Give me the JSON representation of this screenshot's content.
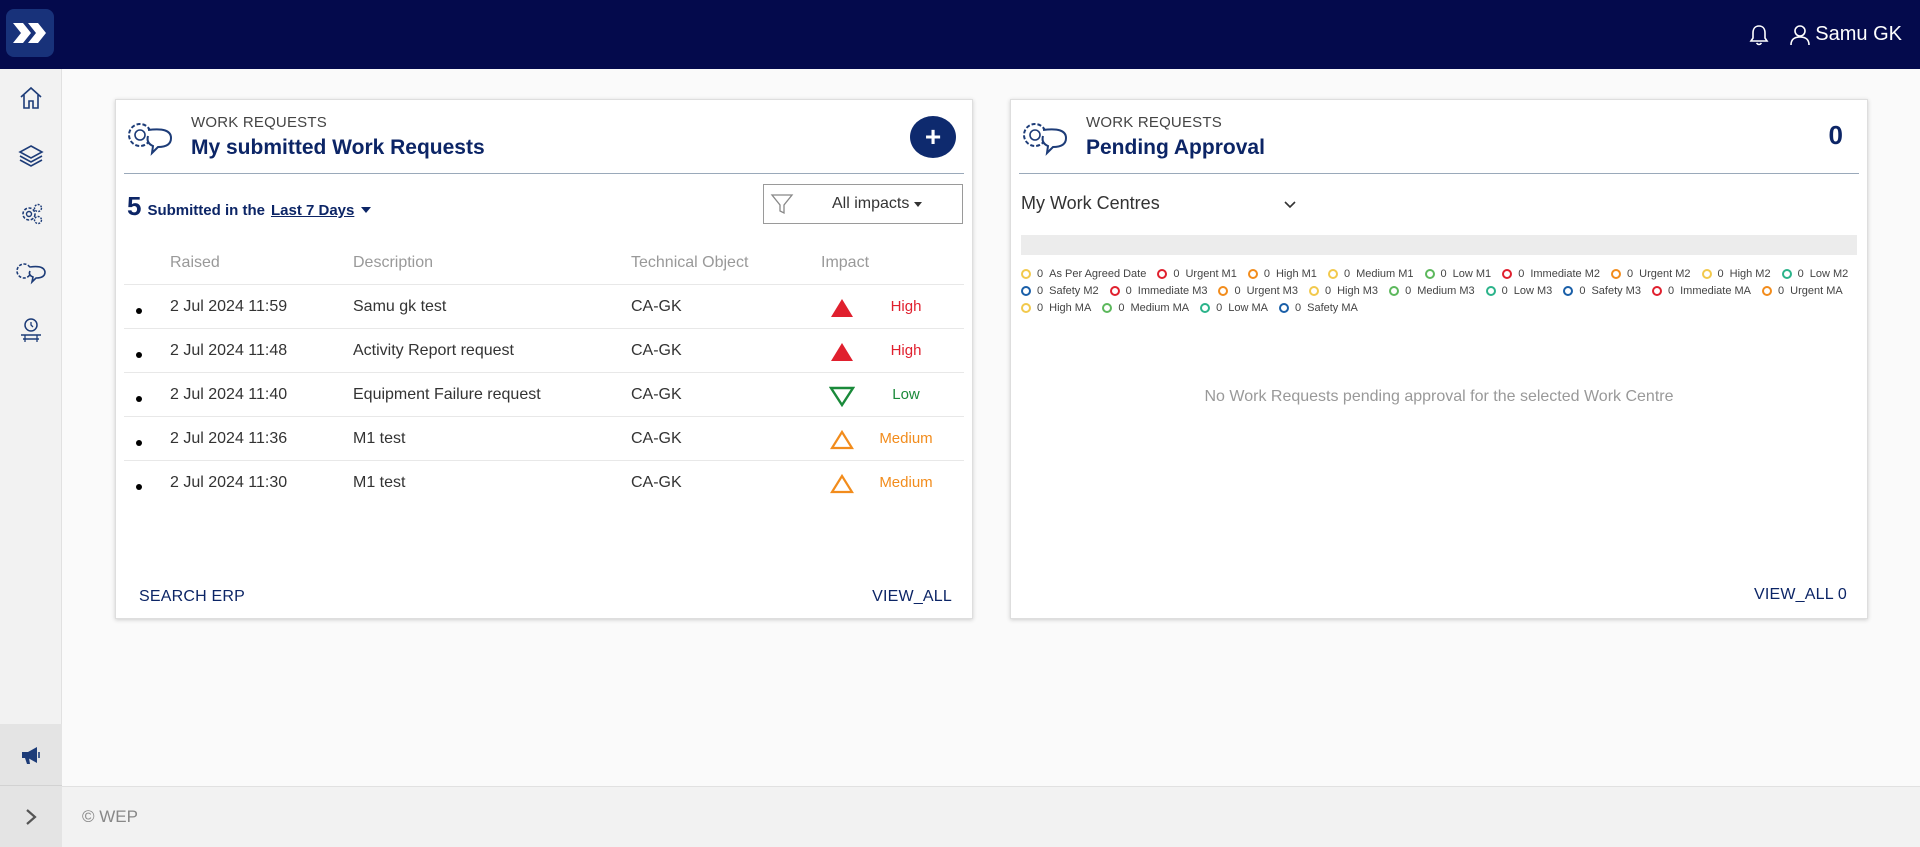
{
  "header": {
    "user_name": "Samu GK"
  },
  "footer": {
    "copyright": "© WEP"
  },
  "card_submitted": {
    "kicker": "WORK REQUESTS",
    "title": "My submitted Work Requests",
    "add_label": "+",
    "count": "5",
    "submitted_label": "Submitted in the",
    "period": "Last 7 Days",
    "filter": "All impacts",
    "columns": [
      "Raised",
      "Description",
      "Technical Object",
      "Impact"
    ],
    "rows": [
      {
        "raised": "2 Jul 2024 11:59",
        "description": "Samu gk test",
        "object": "CA-GK",
        "impact": "High",
        "impact_color": "#e0202e"
      },
      {
        "raised": "2 Jul 2024 11:48",
        "description": "Activity Report request",
        "object": "CA-GK",
        "impact": "High",
        "impact_color": "#e0202e"
      },
      {
        "raised": "2 Jul 2024 11:40",
        "description": "Equipment Failure request",
        "object": "CA-GK",
        "impact": "Low",
        "impact_color": "#1a8a3a"
      },
      {
        "raised": "2 Jul 2024 11:36",
        "description": "M1 test",
        "object": "CA-GK",
        "impact": "Medium",
        "impact_color": "#f28c1c"
      },
      {
        "raised": "2 Jul 2024 11:30",
        "description": "M1 test",
        "object": "CA-GK",
        "impact": "Medium",
        "impact_color": "#f28c1c"
      }
    ],
    "search_link": "SEARCH ERP",
    "view_all_link": "VIEW_ALL"
  },
  "card_pending": {
    "kicker": "WORK REQUESTS",
    "title": "Pending Approval",
    "count": "0",
    "work_centre_select": "My Work Centres",
    "legend": [
      {
        "value": "0",
        "label": "As Per Agreed Date",
        "color": "#f2c94c"
      },
      {
        "value": "0",
        "label": "Urgent M1",
        "color": "#e0202e"
      },
      {
        "value": "0",
        "label": "High M1",
        "color": "#f28c1c"
      },
      {
        "value": "0",
        "label": "Medium M1",
        "color": "#f2c94c"
      },
      {
        "value": "0",
        "label": "Low M1",
        "color": "#5cb85c"
      },
      {
        "value": "0",
        "label": "Immediate M2",
        "color": "#e0202e"
      },
      {
        "value": "0",
        "label": "Urgent M2",
        "color": "#f28c1c"
      },
      {
        "value": "0",
        "label": "High M2",
        "color": "#f2c94c"
      },
      {
        "value": "0",
        "label": "Low M2",
        "color": "#2bb38a"
      },
      {
        "value": "0",
        "label": "Safety M2",
        "color": "#1a5fa8"
      },
      {
        "value": "0",
        "label": "Immediate M3",
        "color": "#e0202e"
      },
      {
        "value": "0",
        "label": "Urgent M3",
        "color": "#f28c1c"
      },
      {
        "value": "0",
        "label": "High M3",
        "color": "#f2c94c"
      },
      {
        "value": "0",
        "label": "Medium M3",
        "color": "#5cb85c"
      },
      {
        "value": "0",
        "label": "Low M3",
        "color": "#2bb38a"
      },
      {
        "value": "0",
        "label": "Safety M3",
        "color": "#1a5fa8"
      },
      {
        "value": "0",
        "label": "Immediate MA",
        "color": "#e0202e"
      },
      {
        "value": "0",
        "label": "Urgent MA",
        "color": "#f28c1c"
      },
      {
        "value": "0",
        "label": "High MA",
        "color": "#f2c94c"
      },
      {
        "value": "0",
        "label": "Medium MA",
        "color": "#5cb85c"
      },
      {
        "value": "0",
        "label": "Low MA",
        "color": "#2bb38a"
      },
      {
        "value": "0",
        "label": "Safety MA",
        "color": "#1a5fa8"
      }
    ],
    "empty_message": "No Work Requests pending approval for the selected Work Centre",
    "view_all_link": "VIEW_ALL 0"
  },
  "sidebar": {
    "items": [
      "home-icon",
      "layers-icon",
      "gears-icon",
      "gear-chat-icon",
      "technician-icon"
    ],
    "bottom": [
      "megaphone-icon",
      "chevron-right-icon"
    ]
  },
  "colors": {
    "topbar": "#040a4c",
    "brand": "#0c2566",
    "high": "#e0202e",
    "medium": "#f28c1c",
    "low": "#1a8a3a"
  }
}
